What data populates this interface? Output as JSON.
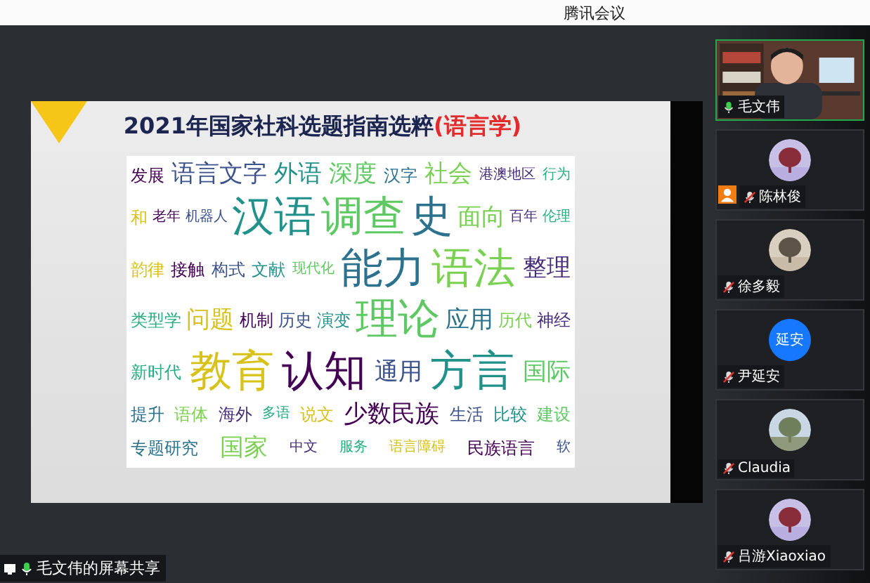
{
  "window": {
    "title": "腾讯会议"
  },
  "slide": {
    "title": "2021年国家社科选题指南选粹",
    "title_suffix": "(语言学)",
    "word_cloud": [
      {
        "text": "发展",
        "kind": "medium"
      },
      {
        "text": "语言文字",
        "kind": "large"
      },
      {
        "text": "外语",
        "kind": "large"
      },
      {
        "text": "深度",
        "kind": "large"
      },
      {
        "text": "汉字",
        "kind": "medium"
      },
      {
        "text": "社会",
        "kind": "large"
      },
      {
        "text": "港澳地区",
        "kind": "small"
      },
      {
        "text": "行为",
        "kind": "small"
      },
      {
        "text": "和",
        "kind": "medium"
      },
      {
        "text": "老年",
        "kind": "small"
      },
      {
        "text": "机器人",
        "kind": "small"
      },
      {
        "text": "汉语",
        "kind": "huge"
      },
      {
        "text": "调查",
        "kind": "huge"
      },
      {
        "text": "史",
        "kind": "huge"
      },
      {
        "text": "面向",
        "kind": "large"
      },
      {
        "text": "百年",
        "kind": "small"
      },
      {
        "text": "伦理",
        "kind": "small"
      },
      {
        "text": "韵律",
        "kind": "medium"
      },
      {
        "text": "接触",
        "kind": "medium"
      },
      {
        "text": "构式",
        "kind": "medium"
      },
      {
        "text": "文献",
        "kind": "medium"
      },
      {
        "text": "现代化",
        "kind": "small"
      },
      {
        "text": "能力",
        "kind": "huge"
      },
      {
        "text": "语法",
        "kind": "huge"
      },
      {
        "text": "整理",
        "kind": "large"
      },
      {
        "text": "类型学",
        "kind": "medium"
      },
      {
        "text": "问题",
        "kind": "large"
      },
      {
        "text": "机制",
        "kind": "medium"
      },
      {
        "text": "历史",
        "kind": "medium"
      },
      {
        "text": "演变",
        "kind": "medium"
      },
      {
        "text": "理论",
        "kind": "huge"
      },
      {
        "text": "应用",
        "kind": "large"
      },
      {
        "text": "历代",
        "kind": "medium"
      },
      {
        "text": "神经",
        "kind": "medium"
      },
      {
        "text": "新时代",
        "kind": "medium"
      },
      {
        "text": "教育",
        "kind": "huge"
      },
      {
        "text": "认知",
        "kind": "huge"
      },
      {
        "text": "通用",
        "kind": "large"
      },
      {
        "text": "方言",
        "kind": "huge"
      },
      {
        "text": "国际",
        "kind": "large"
      },
      {
        "text": "提升",
        "kind": "medium"
      },
      {
        "text": "语体",
        "kind": "medium"
      },
      {
        "text": "海外",
        "kind": "medium"
      },
      {
        "text": "多语",
        "kind": "small"
      },
      {
        "text": "说文",
        "kind": "medium"
      },
      {
        "text": "少数民族",
        "kind": "large"
      },
      {
        "text": "生活",
        "kind": "medium"
      },
      {
        "text": "比较",
        "kind": "medium"
      },
      {
        "text": "建设",
        "kind": "medium"
      },
      {
        "text": "专题研究",
        "kind": "medium"
      },
      {
        "text": "国家",
        "kind": "large"
      },
      {
        "text": "中文",
        "kind": "small"
      },
      {
        "text": "服务",
        "kind": "small"
      },
      {
        "text": "语言障碍",
        "kind": "small"
      },
      {
        "text": "民族语言",
        "kind": "medium"
      },
      {
        "text": "软",
        "kind": "small"
      }
    ]
  },
  "share_label": "毛文伟的屏幕共享",
  "participants": [
    {
      "name": "毛文伟",
      "kind": "video",
      "muted": false,
      "speaking": true,
      "host": false
    },
    {
      "name": "陈林俊",
      "muted": true,
      "speaking": false,
      "host": true
    },
    {
      "name": "徐多毅",
      "muted": true,
      "speaking": false,
      "host": false
    },
    {
      "name": "尹延安",
      "kind": "text",
      "avatar_text": "延安",
      "muted": true,
      "speaking": false,
      "host": false
    },
    {
      "name": "Claudia",
      "muted": true,
      "speaking": false,
      "host": false
    },
    {
      "name": "吕游Xiaoxiao",
      "muted": true,
      "speaking": false,
      "host": false
    }
  ]
}
